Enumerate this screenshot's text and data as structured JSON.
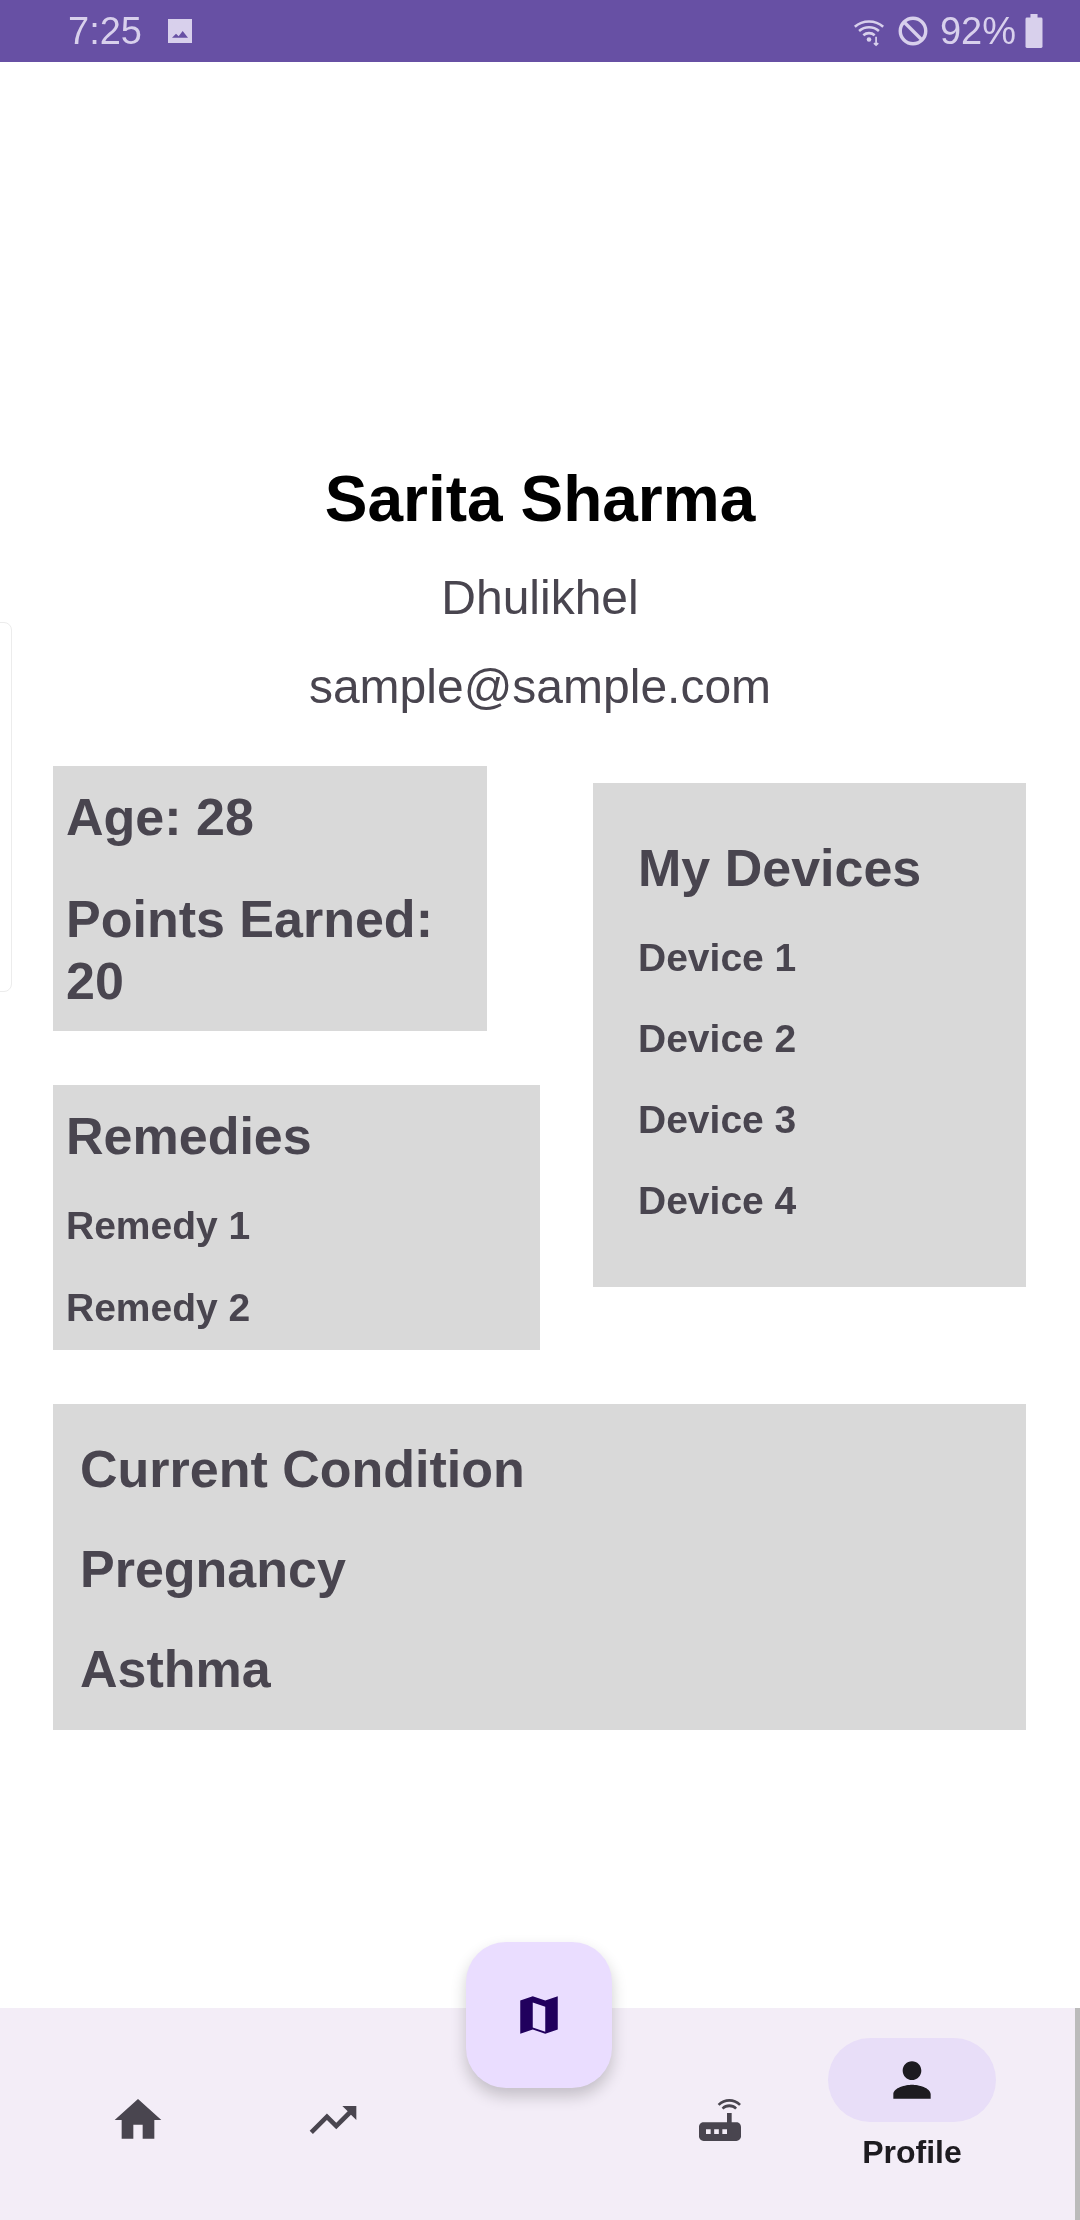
{
  "status_bar": {
    "time": "7:25",
    "battery": "92%"
  },
  "profile": {
    "name": "Sarita Sharma",
    "location": "Dhulikhel",
    "email": "sample@sample.com"
  },
  "stats": {
    "age": "Age: 28",
    "points": "Points Earned: 20"
  },
  "remedies": {
    "title": "Remedies",
    "items": [
      "Remedy 1",
      "Remedy 2"
    ]
  },
  "devices": {
    "title": "My Devices",
    "items": [
      "Device 1",
      "Device 2",
      "Device 3",
      "Device 4"
    ]
  },
  "condition": {
    "title": "Current Condition",
    "items": [
      "Pregnancy",
      "Asthma"
    ]
  },
  "nav": [
    {
      "kind": "home",
      "selected": false
    },
    {
      "kind": "trend",
      "selected": false
    },
    {
      "kind": "map",
      "selected": false
    },
    {
      "kind": "router",
      "selected": false
    },
    {
      "kind": "profile",
      "label": "Profile",
      "selected": true
    }
  ]
}
